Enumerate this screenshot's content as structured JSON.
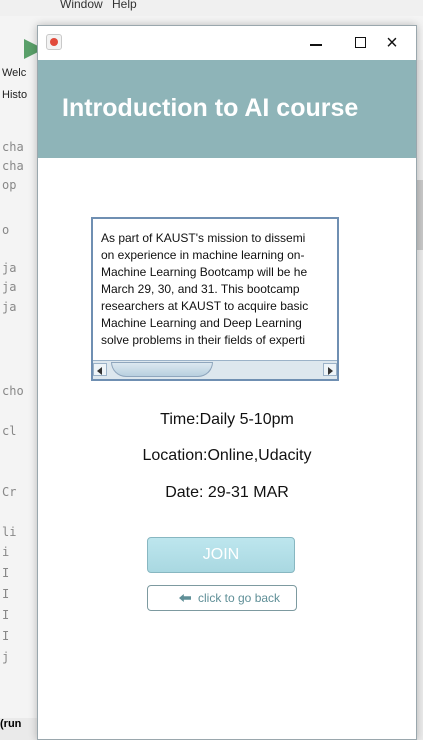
{
  "background": {
    "menu_top": [
      "Window",
      "Help"
    ],
    "tabs": [
      "Welc",
      "Histo"
    ],
    "code_lines": [
      "cha",
      "cha",
      "op",
      "o",
      "ja",
      "ja",
      "ja",
      "cho",
      "cl",
      "Cr",
      "li",
      "i",
      "I",
      "I",
      "I",
      "I",
      "j"
    ],
    "bottom_tab": "(run"
  },
  "window": {
    "title": "Introduction to AI course",
    "controls": {
      "minimize": "",
      "maximize": "",
      "close": "×"
    }
  },
  "course": {
    "description_lines": [
      "As part of KAUST's mission to dissemi",
      "on experience in machine learning on-",
      "Machine Learning Bootcamp will be he",
      " March 29, 30, and 31. This bootcamp",
      "researchers at KAUST to acquire basic",
      "Machine Learning and Deep Learning",
      "solve problems in their fields of experti"
    ],
    "time": "Time:Daily 5-10pm",
    "location": "Location:Online,Udacity",
    "date": "Date: 29-31 MAR"
  },
  "buttons": {
    "join": "JOIN",
    "back": "click to go back"
  },
  "colors": {
    "header": "#8eb4b8",
    "join_bg": "#bde6ee",
    "back_text": "#5f8f97"
  },
  "icons": {
    "app": "java-app-icon",
    "back": "left-arrow-icon"
  }
}
